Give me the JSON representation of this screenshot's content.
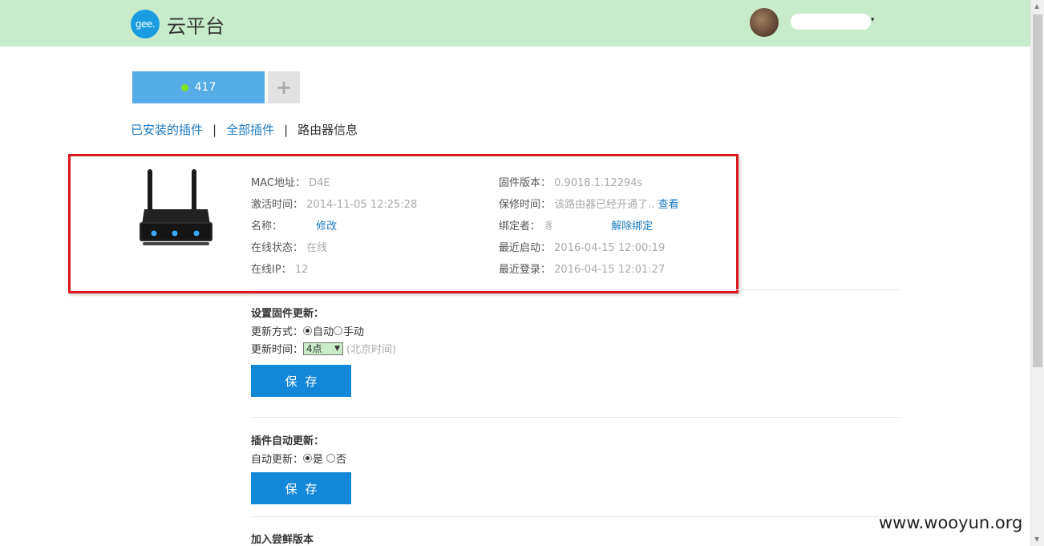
{
  "header": {
    "logo_text": "gee.",
    "brand": "云平台",
    "user_caret": "▾"
  },
  "device_tabs": {
    "active_label": "417",
    "add_label": "+"
  },
  "nav": {
    "installed": "已安装的插件",
    "all": "全部插件",
    "router_info": "路由器信息",
    "separator": "|"
  },
  "router_info": {
    "mac_label": "MAC地址：",
    "mac_value": "D4E",
    "activation_label": "激活时间：",
    "activation_value": "2014-11-05 12:25:28",
    "name_label": "名称：",
    "name_edit": "修改",
    "online_status_label": "在线状态：",
    "online_status_value": "在线",
    "online_ip_label": "在线IP：",
    "online_ip_value": "12",
    "firmware_label": "固件版本：",
    "firmware_value": "0.9018.1.12294s",
    "warranty_label": "保修时间：",
    "warranty_value": "该路由器已经开通了..",
    "warranty_link": "查看",
    "binder_label": "绑定者：",
    "binder_value": "豸",
    "unbind_link": "解除绑定",
    "last_boot_label": "最近启动：",
    "last_boot_value": "2016-04-15 12:00:19",
    "last_login_label": "最近登录：",
    "last_login_value": "2016-04-15 12:01:27"
  },
  "firmware_update": {
    "title": "设置固件更新：",
    "mode_label": "更新方式：",
    "mode_auto": "自动",
    "mode_manual": "手动",
    "time_label": "更新时间：",
    "time_value": "4点",
    "time_caret": "▼",
    "time_hint": "(北京时间)",
    "save": "保存"
  },
  "plugin_update": {
    "title": "插件自动更新：",
    "auto_label": "自动更新：",
    "yes": "是",
    "no": "否",
    "save": "保存"
  },
  "beta": {
    "title": "加入尝鲜版本"
  },
  "watermark": "www.wooyun.org",
  "colors": {
    "header_bg": "#c8ebcb",
    "tab_active": "#55ace6",
    "link": "#1a79c0",
    "button": "#1488d8",
    "highlight_border": "#d9191d",
    "online_dot": "#7ee41c"
  }
}
